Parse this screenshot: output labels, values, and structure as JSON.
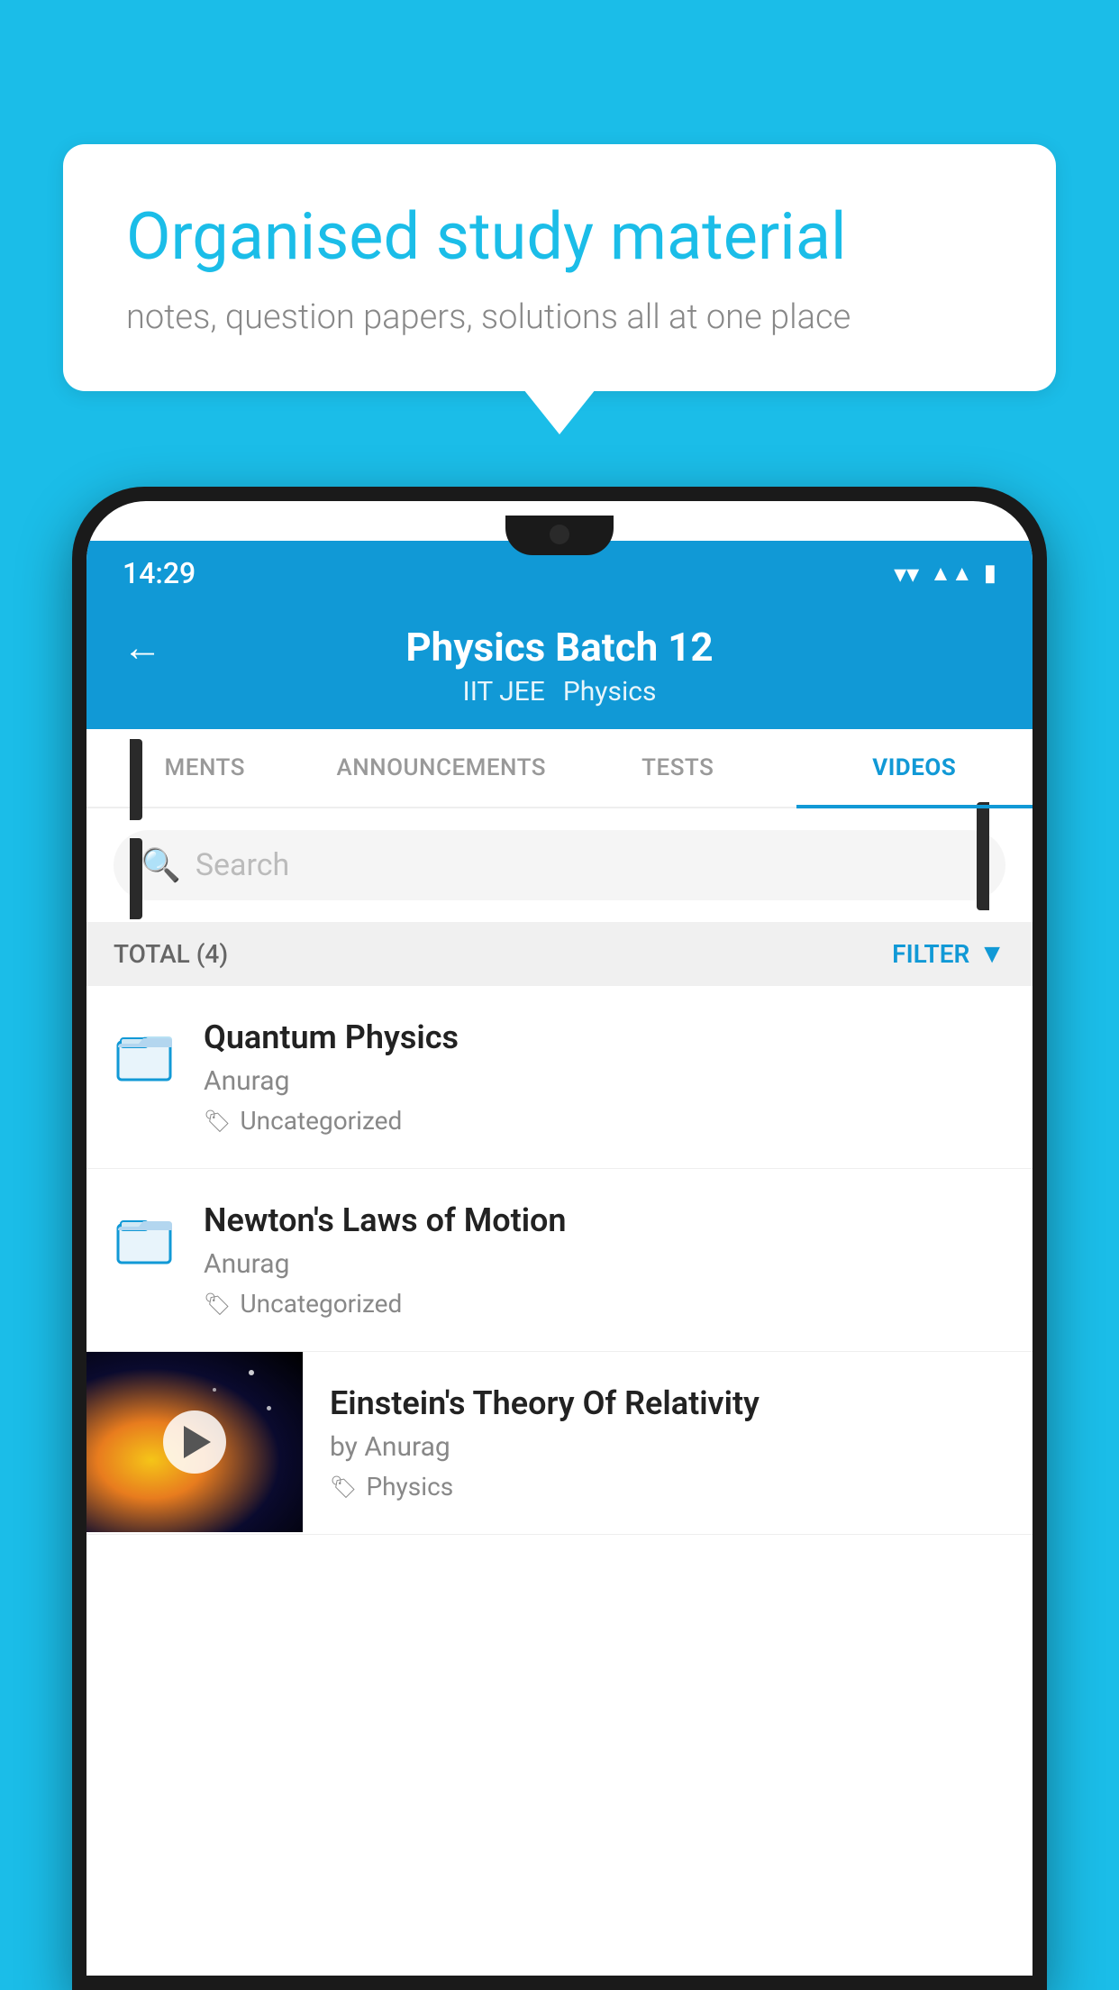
{
  "background_color": "#1bbde8",
  "speech_bubble": {
    "title": "Organised study material",
    "subtitle": "notes, question papers, solutions all at one place"
  },
  "status_bar": {
    "time": "14:29",
    "icons": [
      "wifi",
      "signal",
      "battery"
    ]
  },
  "app_header": {
    "title": "Physics Batch 12",
    "tags": [
      "IIT JEE",
      "Physics"
    ],
    "back_label": "←"
  },
  "tabs": [
    {
      "label": "MENTS",
      "active": false
    },
    {
      "label": "ANNOUNCEMENTS",
      "active": false
    },
    {
      "label": "TESTS",
      "active": false
    },
    {
      "label": "VIDEOS",
      "active": true
    }
  ],
  "search": {
    "placeholder": "Search"
  },
  "filter_bar": {
    "total_label": "TOTAL (4)",
    "filter_label": "FILTER"
  },
  "videos": [
    {
      "title": "Quantum Physics",
      "author": "Anurag",
      "tag": "Uncategorized",
      "has_thumbnail": false
    },
    {
      "title": "Newton's Laws of Motion",
      "author": "Anurag",
      "tag": "Uncategorized",
      "has_thumbnail": false
    },
    {
      "title": "Einstein's Theory Of Relativity",
      "author": "by Anurag",
      "tag": "Physics",
      "has_thumbnail": true
    }
  ],
  "icons": {
    "tag_symbol": "🏷",
    "folder_color": "#1199d6"
  }
}
